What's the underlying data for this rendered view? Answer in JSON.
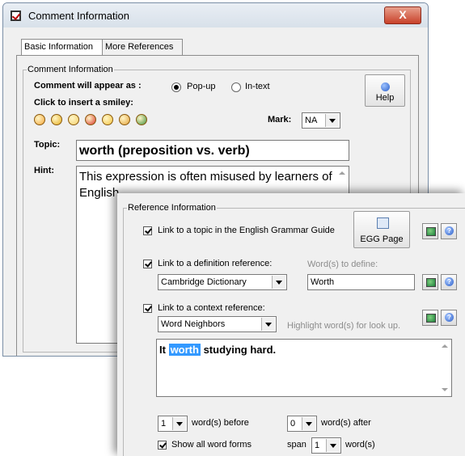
{
  "window": {
    "title": "Comment Information",
    "close_label": "X"
  },
  "tabs": [
    {
      "label": "Basic Information"
    },
    {
      "label": "More References"
    }
  ],
  "comment_info": {
    "legend": "Comment Information",
    "appear_label": "Comment will appear as :",
    "popup_label": "Pop-up",
    "intext_label": "In-text",
    "popup_selected": true,
    "smiley_label": "Click to insert a smiley:",
    "smileys": [
      {
        "icon": "grin-smiley-icon",
        "color": "#f4a63a"
      },
      {
        "icon": "sunglasses-smiley-icon",
        "color": "#e8b020"
      },
      {
        "icon": "sad-smiley-icon",
        "color": "#f2cf6a"
      },
      {
        "icon": "devil-smiley-icon",
        "color": "#d9352b"
      },
      {
        "icon": "laugh-smiley-icon",
        "color": "#f5c542"
      },
      {
        "icon": "nerd-smiley-icon",
        "color": "#e4a23a"
      },
      {
        "icon": "alien-smiley-icon",
        "color": "#3f8f3a"
      }
    ],
    "mark_label": "Mark:",
    "mark_value": "NA",
    "help_label": "Help",
    "topic_label": "Topic:",
    "topic_value": "worth (preposition vs. verb)",
    "hint_label": "Hint:",
    "hint_value": "This expression is often misused by learners of English."
  },
  "reference_info": {
    "legend": "Reference Information",
    "grammar_guide_label": "Link to a topic in the English Grammar Guide",
    "egg_button": "EGG Page",
    "definition_label": "Link to a definition reference:",
    "definition_source": "Cambridge Dictionary",
    "words_to_define_label": "Word(s) to define:",
    "words_to_define_value": "Worth",
    "context_label": "Link to a context reference:",
    "context_source": "Word Neighbors",
    "highlight_hint": "Highlight word(s) for look up.",
    "context_text_before": "It ",
    "context_text_highlight": "worth",
    "context_text_after": " studying hard.",
    "before_value": "1",
    "before_label": "word(s) before",
    "after_value": "0",
    "after_label": "word(s) after",
    "show_forms_label": "Show all word forms",
    "span_label": "span",
    "span_value": "1",
    "span_suffix": "word(s)"
  }
}
